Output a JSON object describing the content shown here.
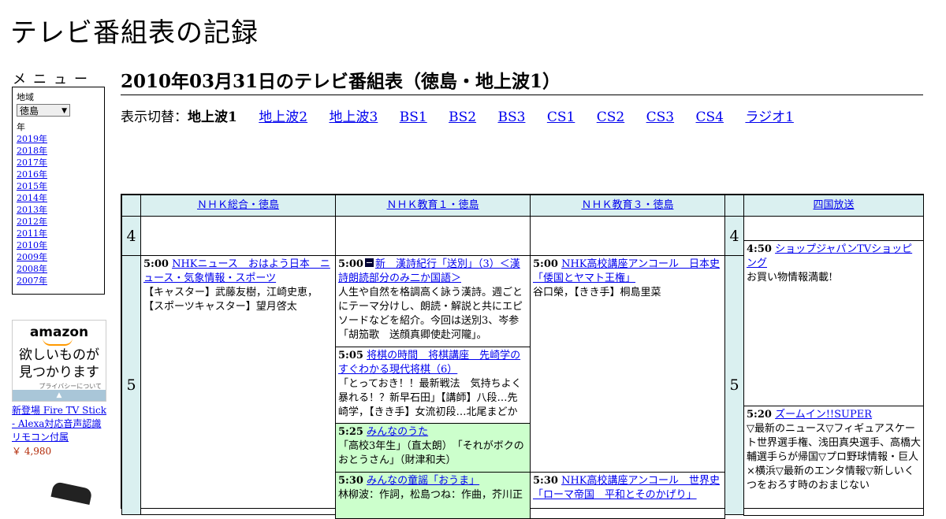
{
  "site": {
    "title": "テレビ番組表の記録"
  },
  "sidebar": {
    "menu_heading": "メニュー",
    "region_label": "地域",
    "region_value": "徳島",
    "year_label": "年",
    "years": [
      "2019年",
      "2018年",
      "2017年",
      "2016年",
      "2015年",
      "2014年",
      "2013年",
      "2012年",
      "2011年",
      "2010年",
      "2009年",
      "2008年",
      "2007年"
    ]
  },
  "ad": {
    "logo": "amazon",
    "copy_line1": "欲しいものが",
    "copy_line2": "見つかります",
    "privacy": "プライバシーについて",
    "product": "新登場 Fire TV Stick - Alexa対応音声認識リモコン付属",
    "price": "￥ 4,980",
    "colors": {
      "logo_smile": "#ff9900",
      "bar": "#a9c6d8",
      "price": "#b12704"
    }
  },
  "main": {
    "title": "2010年03月31日のテレビ番組表（徳島・地上波1）",
    "switch_label": "表示切替：",
    "switch_current": "地上波1",
    "switch_links": [
      "地上波2",
      "地上波3",
      "BS1",
      "BS2",
      "BS3",
      "CS1",
      "CS2",
      "CS3",
      "CS4",
      "ラジオ1"
    ]
  },
  "schedule": {
    "colors": {
      "header_bg": "#daf0f0",
      "highlight_bg": "#ccffcc",
      "link": "#0000ee"
    },
    "channels": [
      "ＮＨＫ総合・徳島",
      "ＮＨＫ教育１・徳島",
      "ＮＨＫ教育３・徳島",
      "四国放送"
    ],
    "hours": [
      "4",
      "5"
    ],
    "programs": {
      "nhk_sogo": [
        {
          "time": "5:00",
          "title": "NHKニュース　おはよう日本　ニュース・気象情報・スポーツ",
          "desc": "【キャスター】武藤友樹，江崎史恵，【スポーツキャスター】望月啓太"
        }
      ],
      "nhk_edu1": [
        {
          "time": "5:00",
          "title": "新　漢詩紀行「送別」（3）＜漢詩朗読部分のみ二か国語＞",
          "desc": "人生や自然を格調高く詠う漢詩。週ごとにテーマ分けし、朗読・解説と共にエピソードなどを紹介。今回は送別3、岑参「胡笳歌　送顔真卿使赴河隴」。"
        },
        {
          "time": "5:05",
          "title": "将棋の時間　将棋講座　先崎学のすぐわかる現代将棋（6）",
          "desc": "「とっておき！！最新戦法　気持ちよく暴れる！？新早石田」【講師】八段…先崎学，【きき手】女流初段…北尾まどか"
        },
        {
          "time": "5:25",
          "title": "みんなのうた",
          "desc": "「高校3年生」（直太朗）　「それがボクのおとうさん」（財津和夫）"
        },
        {
          "time": "5:30",
          "title": "みんなの童謡「おうま」",
          "desc": "林柳波：作詞，松島つね：作曲，芥川正"
        }
      ],
      "nhk_edu3": [
        {
          "time": "5:00",
          "title": "NHK高校講座アンコール　日本史「倭国とヤマト王権」",
          "desc": "谷口榮，【きき手】桐島里菜"
        },
        {
          "time": "5:30",
          "title": "NHK高校講座アンコール　世界史「ローマ帝国　平和とそのかげり」",
          "desc": ""
        }
      ],
      "shikoku": [
        {
          "time": "4:50",
          "title": "ショップジャパンTVショッピング",
          "desc": "お買い物情報満載!"
        },
        {
          "time": "5:20",
          "title": "ズームイン!!SUPER",
          "desc": "▽最新のニュース▽フィギュアスケート世界選手権、浅田真央選手、高橋大輔選手らが帰国▽プロ野球情報・巨人×横浜▽最新のエンタ情報▽新しいくつをおろす時のおまじない"
        }
      ]
    }
  }
}
